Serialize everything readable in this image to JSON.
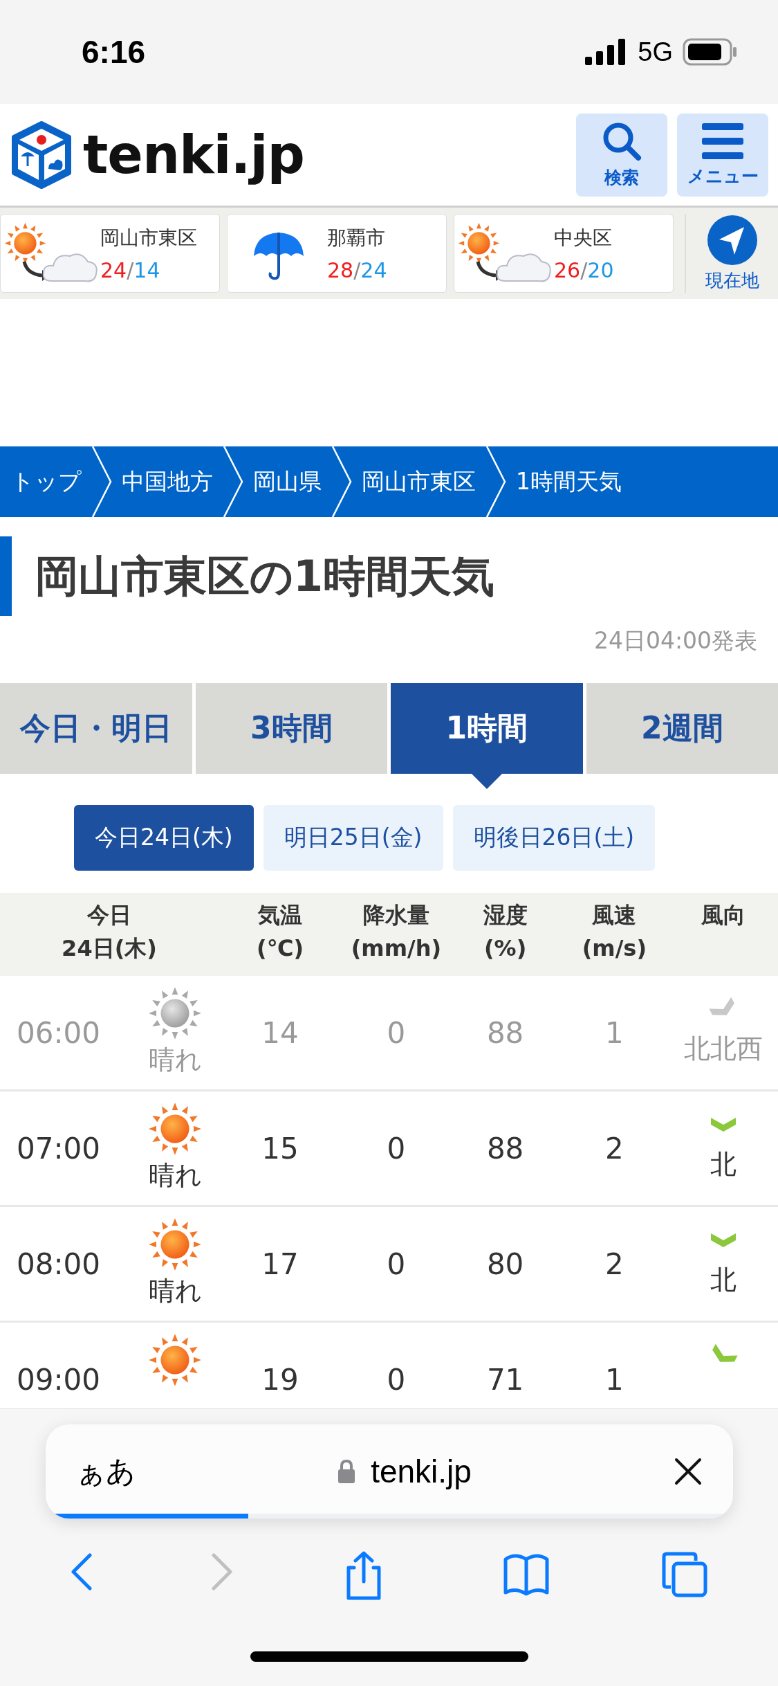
{
  "status_bar": {
    "time": "6:16",
    "network": "5G"
  },
  "header": {
    "logo_text": "tenki.jp",
    "buttons": [
      {
        "kind": "search",
        "label": "検索"
      },
      {
        "kind": "menu",
        "label": "メニュー"
      }
    ]
  },
  "locations": [
    {
      "name": "岡山市東区",
      "kind": "sun-cloud",
      "high": "24",
      "separator": "/",
      "low": "14"
    },
    {
      "name": "那覇市",
      "kind": "umbrella",
      "high": "28",
      "separator": "/",
      "low": "24"
    },
    {
      "name": "中央区",
      "kind": "sun-cloud",
      "high": "26",
      "separator": "/",
      "low": "20"
    }
  ],
  "current_location": {
    "label": "現在地"
  },
  "breadcrumb": [
    "トップ",
    "中国地方",
    "岡山県",
    "岡山市東区",
    "1時間天気"
  ],
  "page_title": "岡山市東区の1時間天気",
  "issued": "24日04:00発表",
  "tabs": [
    {
      "label": "今日・明日",
      "selected": false
    },
    {
      "label": "3時間",
      "selected": false
    },
    {
      "label": "1時間",
      "selected": true
    },
    {
      "label": "2週間",
      "selected": false
    }
  ],
  "days": [
    {
      "label": "今日24日(木)",
      "selected": true
    },
    {
      "label": "明日25日(金)",
      "selected": false
    },
    {
      "label": "明後日26日(土)",
      "selected": false
    }
  ],
  "table": {
    "columns": [
      {
        "line1": "今日",
        "line2": "24日(木)"
      },
      {
        "line1": "気温",
        "line2": "(℃)"
      },
      {
        "line1": "降水量",
        "line2": "(mm/h)"
      },
      {
        "line1": "湿度",
        "line2": "(%)"
      },
      {
        "line1": "風速",
        "line2": "(m/s)"
      },
      {
        "line1": "風向"
      }
    ],
    "rows": [
      {
        "time": "06:00",
        "weather": {
          "kind": "sunny",
          "label": "晴れ"
        },
        "temp": "14",
        "precip": "0",
        "humidity": "88",
        "wind_speed": "1",
        "wind_direction": {
          "kind": "nnw",
          "label": "北北西"
        },
        "past": true
      },
      {
        "time": "07:00",
        "weather": {
          "kind": "sunny",
          "label": "晴れ"
        },
        "temp": "15",
        "precip": "0",
        "humidity": "88",
        "wind_speed": "2",
        "wind_direction": {
          "kind": "n",
          "label": "北"
        },
        "past": false
      },
      {
        "time": "08:00",
        "weather": {
          "kind": "sunny",
          "label": "晴れ"
        },
        "temp": "17",
        "precip": "0",
        "humidity": "80",
        "wind_speed": "2",
        "wind_direction": {
          "kind": "n",
          "label": "北"
        },
        "past": false
      },
      {
        "time": "09:00",
        "weather": {
          "kind": "sunny"
        },
        "temp": "19",
        "precip": "0",
        "humidity": "71",
        "wind_speed": "1",
        "wind_direction": {
          "kind": "nne"
        },
        "past": false
      }
    ]
  },
  "browser": {
    "text_size": "ぁあ",
    "url": "tenki.jp",
    "load": {
      "level": 0.29
    },
    "toolbar": [
      {
        "kind": "back",
        "disabled": false
      },
      {
        "kind": "forward",
        "disabled": true
      },
      {
        "kind": "share",
        "disabled": false
      },
      {
        "kind": "bookmarks",
        "disabled": false
      },
      {
        "kind": "tabs",
        "disabled": false
      }
    ]
  }
}
